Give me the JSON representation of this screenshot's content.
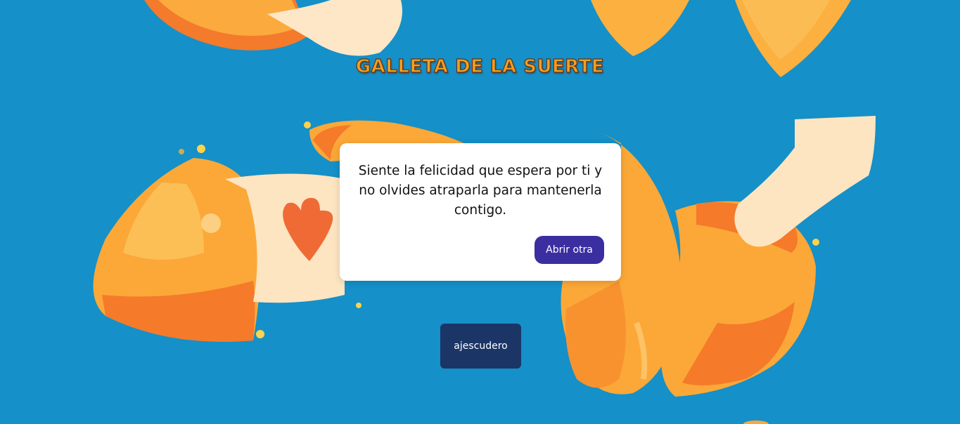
{
  "page": {
    "title": "GALLETA DE LA SUERTE",
    "background_color": "#1590c8"
  },
  "fortune": {
    "message": "Siente la felicidad que espera por ti y no olvides atraparla para mantenerla contigo.",
    "open_button_label": "Abrir otra",
    "button_color": "#3b2ea0"
  },
  "footer": {
    "author_label": "ajescudero",
    "author_color": "#1c3567"
  }
}
